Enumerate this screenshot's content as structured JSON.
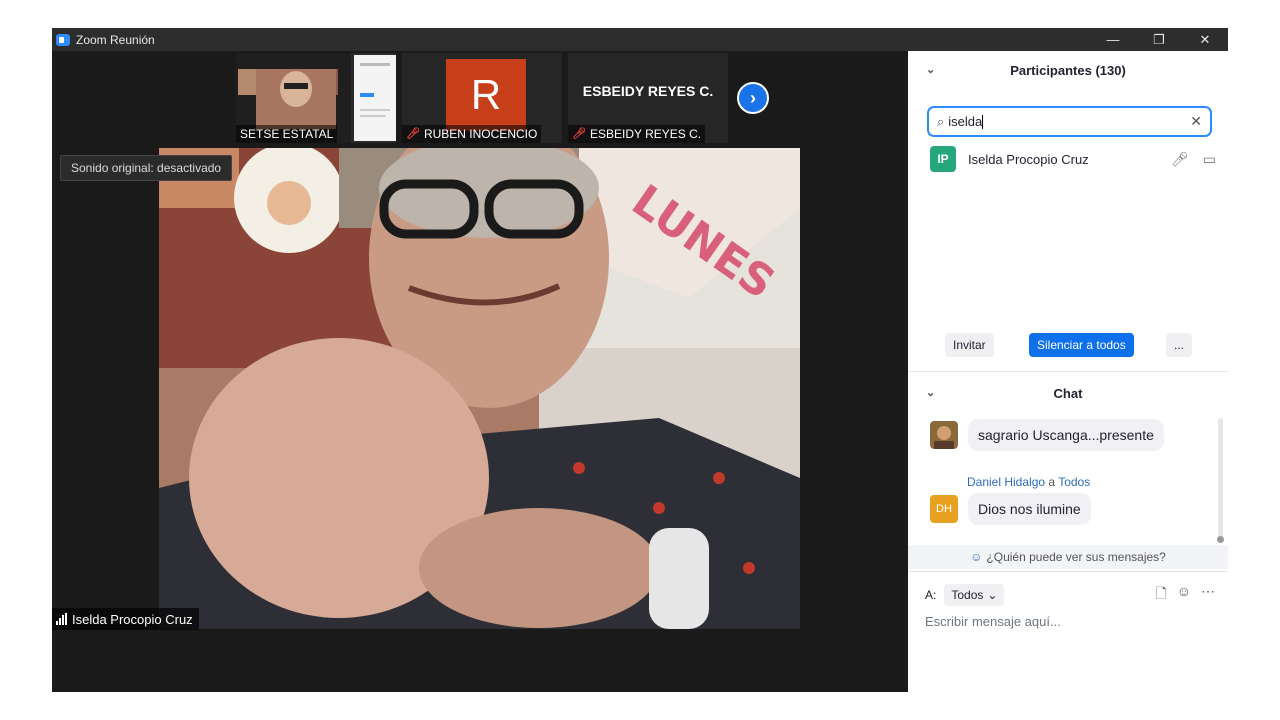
{
  "window": {
    "title": "Zoom Reunión",
    "controls": {
      "minimize": "—",
      "restore": "❐",
      "close": "✕"
    }
  },
  "video": {
    "thumbnails": [
      {
        "label": "SETSE ESTATAL",
        "muted": false
      },
      {
        "label": "RUBEN INOCENCIO",
        "muted": true,
        "avatar_letter": "R",
        "avatar_color": "#c8401a"
      },
      {
        "label": "ESBEIDY REYES C.",
        "muted": true,
        "display_name": "ESBEIDY REYES C."
      }
    ],
    "next_icon": "›",
    "sound_tooltip": "Sonido original: desactivado",
    "active_speaker": "Iselda Procopio Cruz"
  },
  "participants": {
    "header": "Participantes (130)",
    "search_value": "iselda",
    "results": [
      {
        "initials": "IP",
        "name": "Iselda Procopio Cruz",
        "avatar_color": "#26a67b"
      }
    ],
    "buttons": {
      "invite": "Invitar",
      "mute_all": "Silenciar a todos",
      "more": "..."
    }
  },
  "chat": {
    "header": "Chat",
    "messages": [
      {
        "text": "sagrario Uscanga...presente"
      },
      {
        "sender": "Daniel Hidalgo",
        "to_word": "a",
        "recipient": "Todos",
        "initials": "DH",
        "avatar_color": "#e8a020",
        "text": "Dios nos ilumine"
      }
    ],
    "who_can_see": "¿Quién puede ver sus mensajes?",
    "to_label": "A:",
    "to_value": "Todos",
    "placeholder": "Escribir mensaje aquí..."
  },
  "colors": {
    "accent": "#0e71eb",
    "focus": "#2d8cff"
  }
}
